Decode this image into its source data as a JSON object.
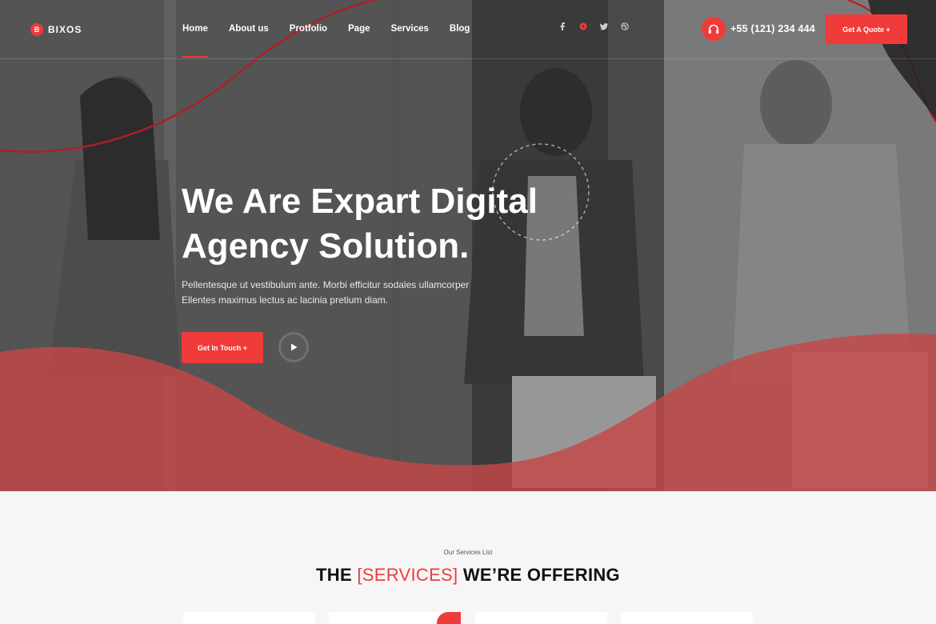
{
  "brand": {
    "logo_letter": "B",
    "logo_text": "BIXOS"
  },
  "nav": [
    {
      "label": "Home",
      "active": true
    },
    {
      "label": "About us",
      "active": false
    },
    {
      "label": "Protfolio",
      "active": false
    },
    {
      "label": "Page",
      "active": false
    },
    {
      "label": "Services",
      "active": false
    },
    {
      "label": "Blog",
      "active": false
    }
  ],
  "socials": [
    "facebook-icon",
    "pinterest-icon",
    "twitter-icon",
    "dribbble-icon"
  ],
  "contact": {
    "phone": "+55 (121) 234 444"
  },
  "header": {
    "quote_label": "Get A Quote +"
  },
  "hero": {
    "title_line1": "We Are Expart Digital",
    "title_line2": "Agency Solution.",
    "subtitle_line1": "Pellentesque ut vestibulum ante. Morbi efficitur sodales ullamcorper",
    "subtitle_line2": "Ellentes maximus lectus ac lacinia pretium diam.",
    "cta_label": "Get In Touch +"
  },
  "services": {
    "eyebrow": "Our Services List",
    "title_pre": "THE ",
    "title_accent": "[SERVICES]",
    "title_post": " WE’RE OFFERING"
  },
  "colors": {
    "accent": "#f03b3b",
    "dark": "#111111",
    "background": "#f6f6f6"
  }
}
